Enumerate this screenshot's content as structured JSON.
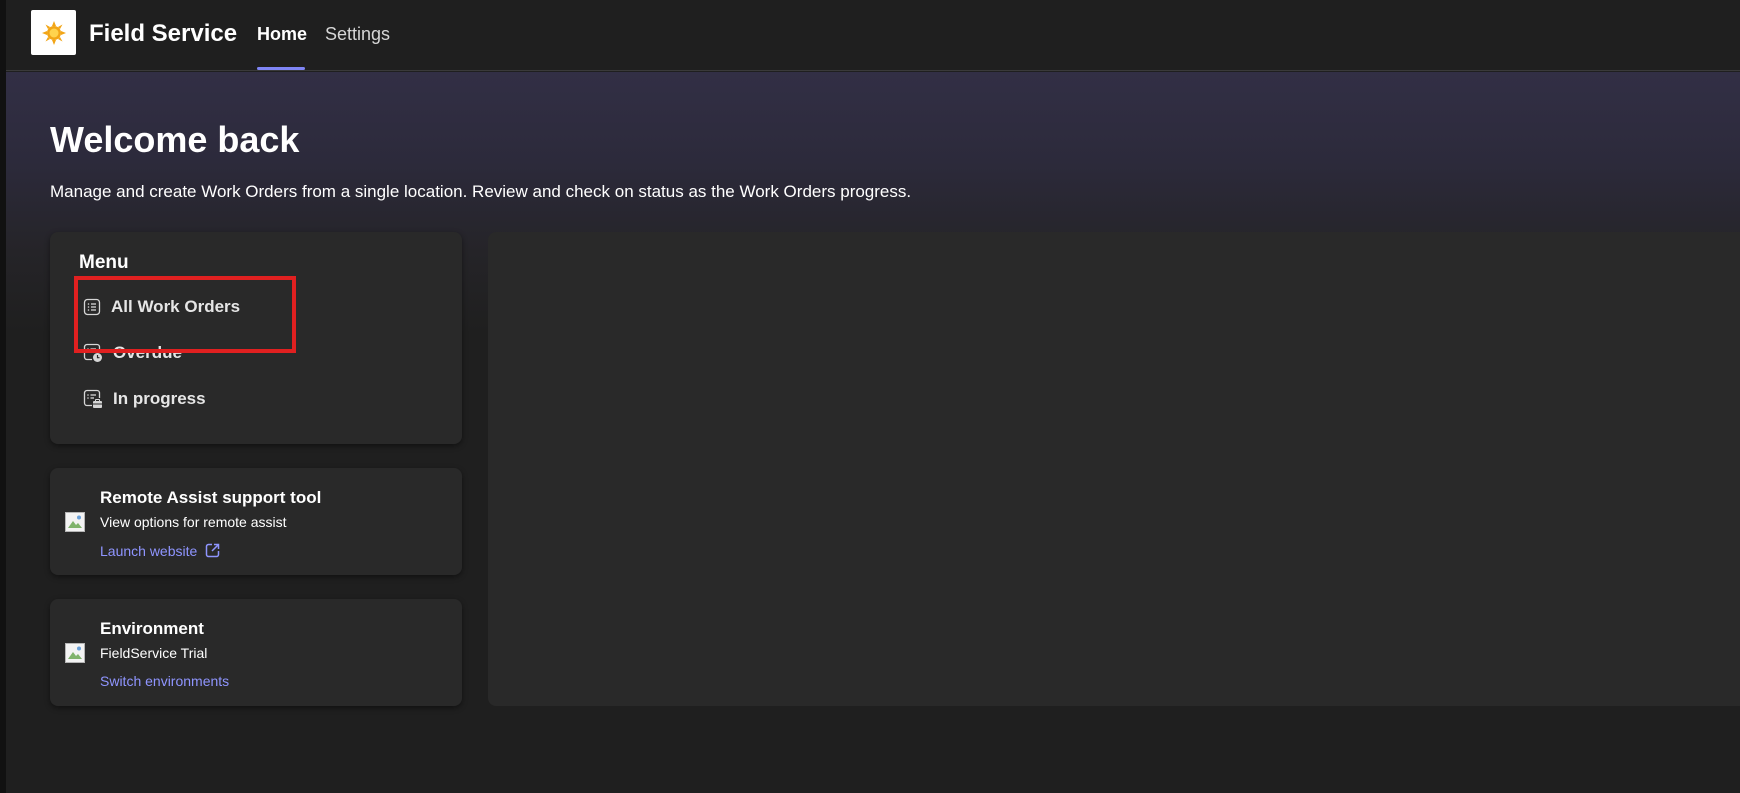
{
  "app": {
    "title": "Field Service",
    "logo_icon": "sun-icon"
  },
  "nav": {
    "tabs": [
      {
        "label": "Home",
        "active": true
      },
      {
        "label": "Settings",
        "active": false
      }
    ],
    "accent_color": "#7f85f5"
  },
  "header": {
    "welcome": "Welcome back",
    "subtitle": "Manage and create Work Orders from a single location. Review and check on status as the Work Orders progress."
  },
  "menu": {
    "title": "Menu",
    "items": [
      {
        "label": "All Work Orders",
        "icon": "list-icon",
        "highlighted": true
      },
      {
        "label": "Overdue",
        "icon": "list-clock-icon"
      },
      {
        "label": "In progress",
        "icon": "list-toolbox-icon"
      }
    ]
  },
  "remote_assist": {
    "title": "Remote Assist support tool",
    "description": "View options for remote assist",
    "link_label": "Launch website",
    "link_icon": "open-external-icon"
  },
  "environment": {
    "title": "Environment",
    "value": "FieldService Trial",
    "link_label": "Switch environments"
  },
  "colors": {
    "highlight_border": "#e02020",
    "link": "#8f95ff"
  }
}
